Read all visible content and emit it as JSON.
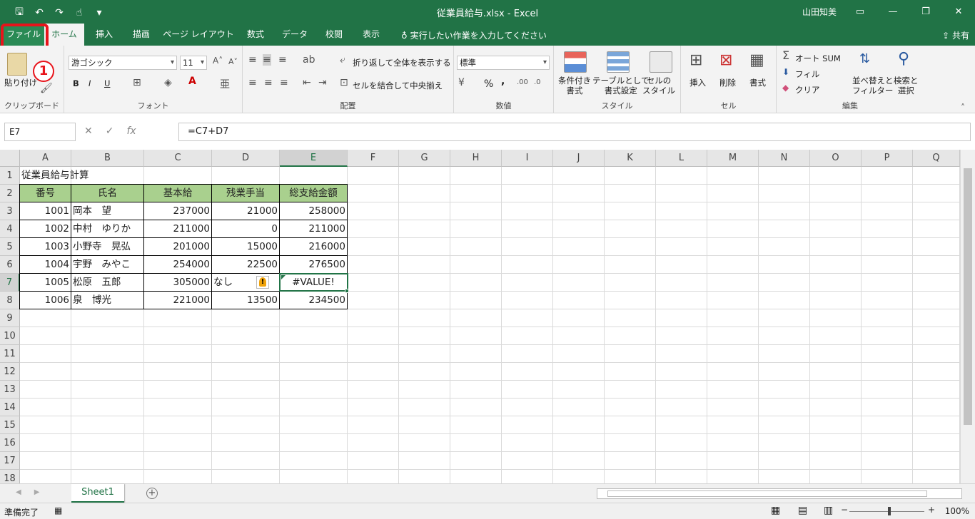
{
  "window": {
    "title": "従業員給与.xlsx  -  Excel",
    "user": "山田知美",
    "min_label": "—",
    "max_label": "❐",
    "close_label": "✕",
    "share": "共有"
  },
  "qat": {
    "save": "🖫",
    "undo": "↶",
    "redo": "↷",
    "touch": "☝",
    "more": "▾"
  },
  "tabs": [
    "ファイル",
    "ホーム",
    "挿入",
    "描画",
    "ページ レイアウト",
    "数式",
    "データ",
    "校閲",
    "表示"
  ],
  "tellme": "実行したい作業を入力してください",
  "step_badge": "1",
  "ribbon": {
    "clipboard": {
      "paste": "貼り付け",
      "label": "クリップボード"
    },
    "font": {
      "name": "游ゴシック",
      "size": "11",
      "bold": "B",
      "italic": "I",
      "underline": "U",
      "label": "フォント"
    },
    "alignment": {
      "wrap": "折り返して全体を表示する",
      "merge": "セルを結合して中央揃え",
      "label": "配置"
    },
    "number": {
      "format": "標準",
      "percent": "%",
      "comma": ",",
      "label": "数値"
    },
    "styles": {
      "conditional": [
        "条件付き",
        "書式"
      ],
      "table": [
        "テーブルとして",
        "書式設定"
      ],
      "cell": [
        "セルの",
        "スタイル"
      ],
      "label": "スタイル"
    },
    "cells": {
      "insert": "挿入",
      "delete": "削除",
      "format": "書式",
      "label": "セル"
    },
    "editing": {
      "autosum": "オート SUM",
      "fill": "フィル",
      "clear": "クリア",
      "sort": [
        "並べ替えと",
        "フィルター"
      ],
      "find": [
        "検索と",
        "選択"
      ],
      "label": "編集"
    }
  },
  "formula_bar": {
    "name_box": "E7",
    "formula": "=C7+D7"
  },
  "columns": [
    "A",
    "B",
    "C",
    "D",
    "E",
    "F",
    "G",
    "H",
    "I",
    "J",
    "K",
    "L",
    "M",
    "N",
    "O",
    "P",
    "Q"
  ],
  "rows": [
    "1",
    "2",
    "3",
    "4",
    "5",
    "6",
    "7",
    "8",
    "9",
    "10",
    "11",
    "12",
    "13",
    "14",
    "15",
    "16",
    "17",
    "18"
  ],
  "sheet": {
    "title": "従業員給与計算",
    "headers": [
      "番号",
      "氏名",
      "基本給",
      "残業手当",
      "総支給金額"
    ],
    "data": [
      [
        "1001",
        "岡本　望",
        "237000",
        "21000",
        "258000"
      ],
      [
        "1002",
        "中村　ゆりか",
        "211000",
        "0",
        "211000"
      ],
      [
        "1003",
        "小野寺　晃弘",
        "201000",
        "15000",
        "216000"
      ],
      [
        "1004",
        "宇野　みやこ",
        "254000",
        "22500",
        "276500"
      ],
      [
        "1005",
        "松原　五郎",
        "305000",
        "なし",
        "#VALUE!"
      ],
      [
        "1006",
        "泉　博光",
        "221000",
        "13500",
        "234500"
      ]
    ]
  },
  "sheet_tabs": [
    "Sheet1"
  ],
  "status": {
    "ready": "準備完了",
    "zoom": "100%"
  }
}
